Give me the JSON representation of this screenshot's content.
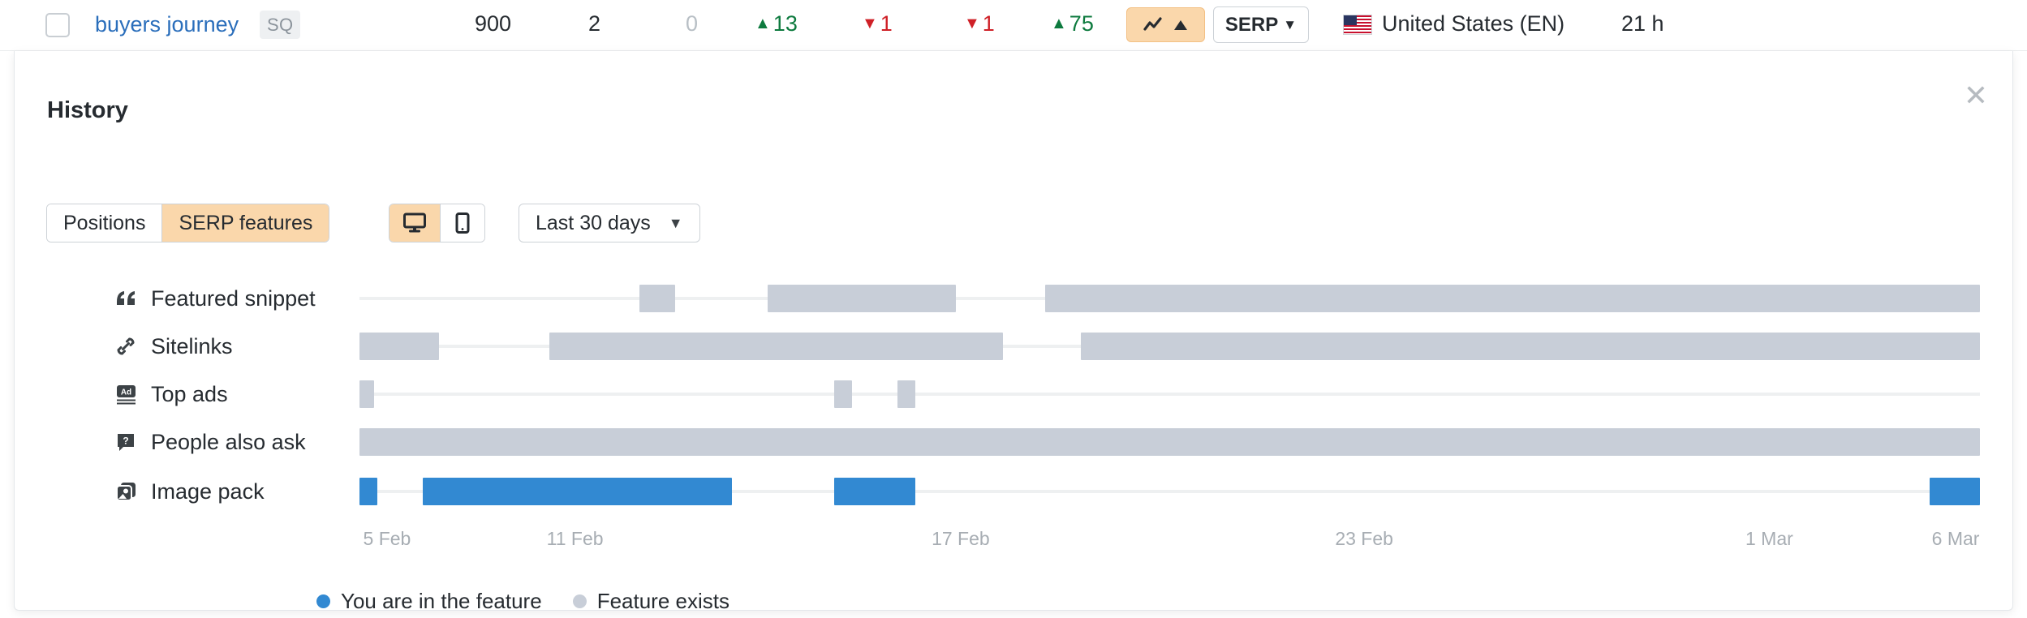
{
  "keyword_row": {
    "keyword": "buyers journey",
    "badge": "SQ",
    "volume": "900",
    "kd": "2",
    "cpc": "0",
    "deltas": [
      {
        "dir": "up",
        "glyph": "▲",
        "value": "13"
      },
      {
        "dir": "down",
        "glyph": "▼",
        "value": "1"
      },
      {
        "dir": "down",
        "glyph": "▼",
        "value": "1"
      },
      {
        "dir": "up",
        "glyph": "▲",
        "value": "75"
      }
    ],
    "history_button": "history-trend-icon",
    "serp_button": "SERP",
    "serp_caret": "▼",
    "location": "United States (EN)",
    "updated": "21 h"
  },
  "panel": {
    "title": "History",
    "close_glyph": "✕",
    "tabs": [
      {
        "label": "Positions",
        "active": false
      },
      {
        "label": "SERP features",
        "active": true
      }
    ],
    "devices": [
      {
        "name": "desktop-icon",
        "active": true
      },
      {
        "name": "mobile-icon",
        "active": false
      }
    ],
    "date_range": {
      "label": "Last 30 days",
      "caret": "▼"
    }
  },
  "chart_data": {
    "type": "table",
    "title": "History — SERP features",
    "xlabel": "",
    "ylabel": "",
    "grid": false,
    "legend_position": "bottom",
    "x_range": [
      "5 Feb",
      "6 Mar"
    ],
    "x_ticks": [
      {
        "label": "5 Feb",
        "pct": 1.7
      },
      {
        "label": "11 Feb",
        "pct": 13.3
      },
      {
        "label": "17 Feb",
        "pct": 37.1
      },
      {
        "label": "23 Feb",
        "pct": 62.0
      },
      {
        "label": "1 Mar",
        "pct": 87.0
      },
      {
        "label": "6 Mar",
        "pct": 98.5
      }
    ],
    "legend": [
      {
        "label": "You are in the feature",
        "color": "#3289d2"
      },
      {
        "label": "Feature exists",
        "color": "#c8ced8"
      }
    ],
    "rows": [
      {
        "feature": "Featured snippet",
        "icon": "quote-icon",
        "segments": [
          {
            "state": "exists",
            "start_pct": 17.3,
            "end_pct": 19.5
          },
          {
            "state": "exists",
            "start_pct": 25.2,
            "end_pct": 36.8
          },
          {
            "state": "exists",
            "start_pct": 42.3,
            "end_pct": 100.0
          }
        ]
      },
      {
        "feature": "Sitelinks",
        "icon": "link-icon",
        "segments": [
          {
            "state": "exists",
            "start_pct": 0.0,
            "end_pct": 4.9
          },
          {
            "state": "exists",
            "start_pct": 11.7,
            "end_pct": 39.7
          },
          {
            "state": "exists",
            "start_pct": 44.5,
            "end_pct": 100.0
          }
        ]
      },
      {
        "feature": "Top ads",
        "icon": "ad-icon",
        "segments": [
          {
            "state": "exists",
            "start_pct": 0.0,
            "end_pct": 0.9
          },
          {
            "state": "exists",
            "start_pct": 29.3,
            "end_pct": 30.4
          },
          {
            "state": "exists",
            "start_pct": 33.2,
            "end_pct": 34.3
          }
        ]
      },
      {
        "feature": "People also ask",
        "icon": "question-bubble-icon",
        "segments": [
          {
            "state": "exists",
            "start_pct": 0.0,
            "end_pct": 100.0
          }
        ]
      },
      {
        "feature": "Image pack",
        "icon": "image-pack-icon",
        "segments": [
          {
            "state": "in_feature",
            "start_pct": 0.0,
            "end_pct": 1.1
          },
          {
            "state": "in_feature",
            "start_pct": 3.9,
            "end_pct": 23.0
          },
          {
            "state": "in_feature",
            "start_pct": 29.3,
            "end_pct": 34.3
          },
          {
            "state": "in_feature",
            "start_pct": 96.9,
            "end_pct": 100.0
          }
        ]
      }
    ]
  },
  "colors": {
    "in_feature": "#3289d2",
    "feature_exists": "#c8ced8",
    "accent": "#fad7ab",
    "link": "#2a6ebb",
    "up": "#0d7a3e",
    "down": "#cf2027"
  }
}
